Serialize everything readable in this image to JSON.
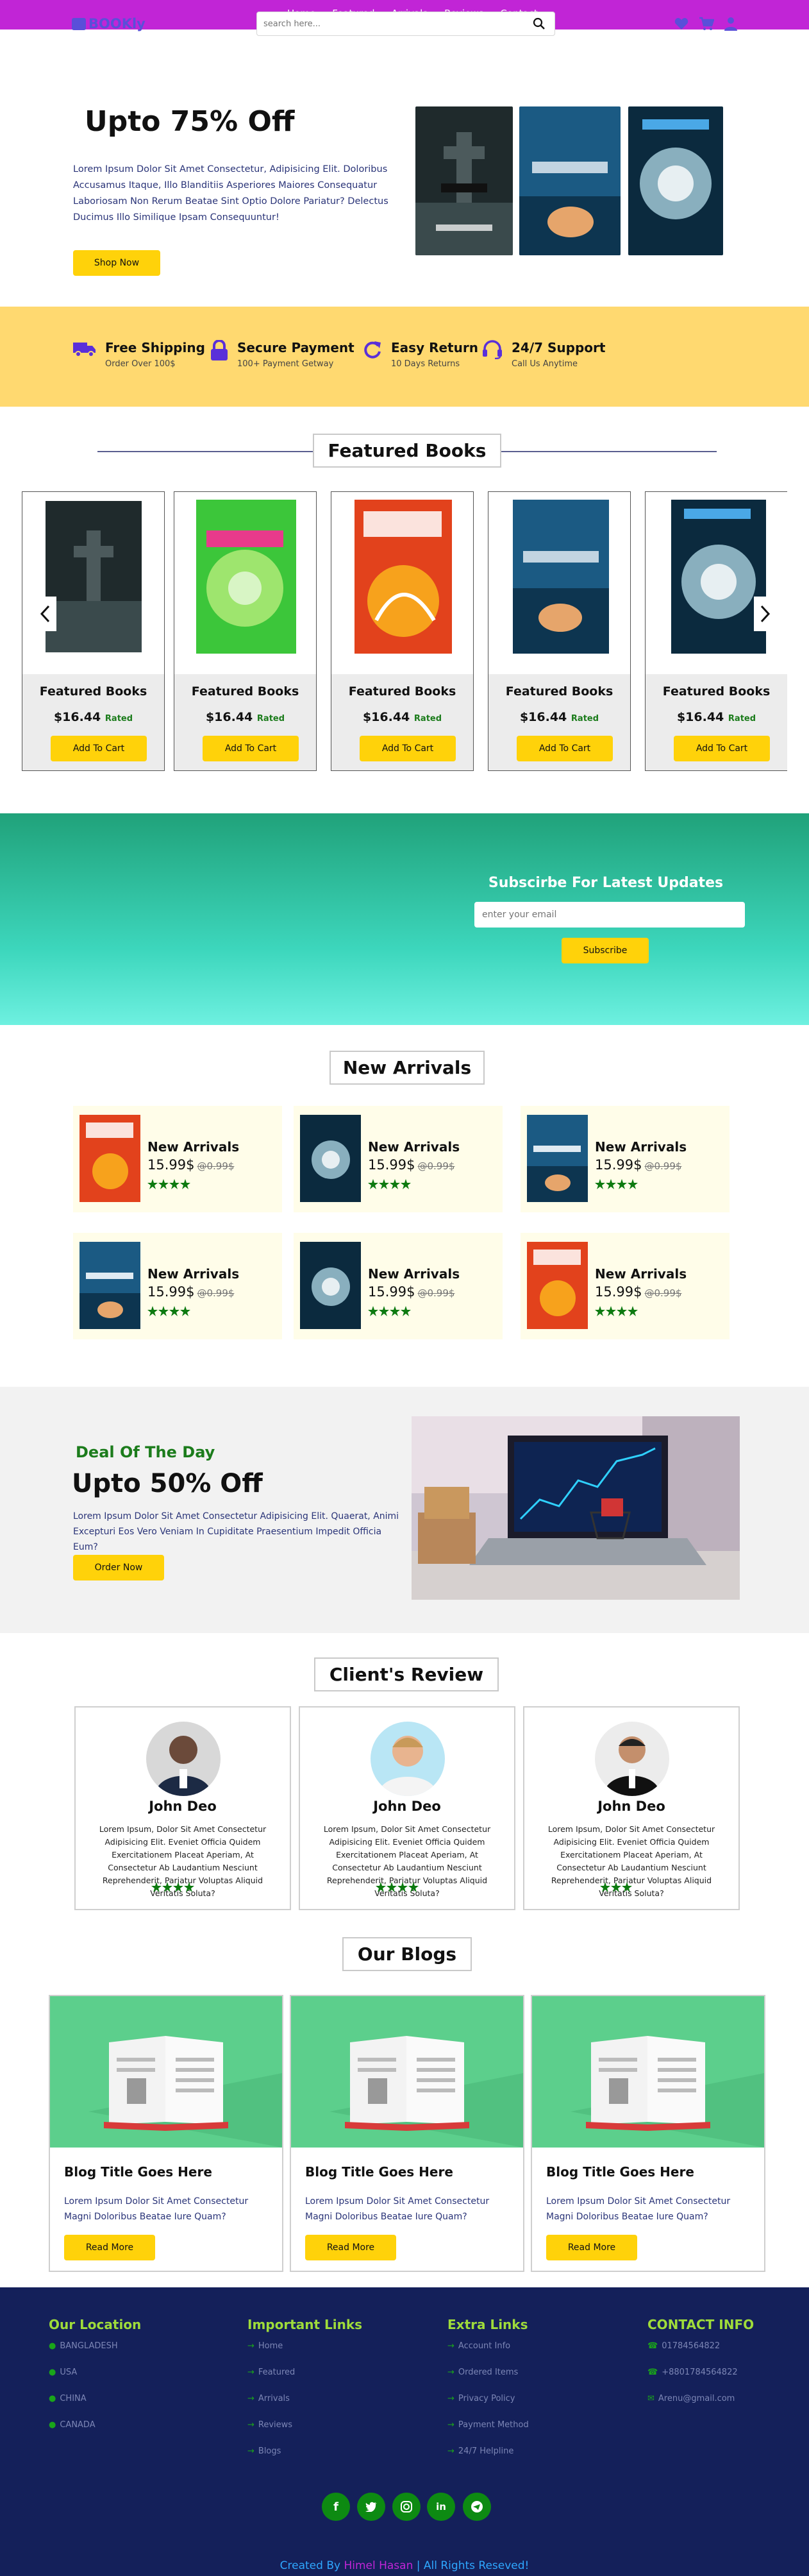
{
  "header": {
    "logo": "BOOKly",
    "nav": [
      "Home",
      "Featured",
      "Arrivals",
      "Reviews",
      "Contact"
    ],
    "search_placeholder": "search here..."
  },
  "hero": {
    "title": "Upto 75% Off",
    "text": "Lorem Ipsum Dolor Sit Amet Consectetur, Adipisicing Elit. Doloribus Accusamus Itaque, Illo Blanditiis Asperiores Maiores Consequatur Laboriosam Non Rerum Beatae Sint Optio Dolore Pariatur? Delectus Ducimus Illo Similique Ipsam Consequuntur!",
    "button": "Shop Now"
  },
  "benefits": [
    {
      "icon": "truck-icon",
      "title": "Free Shipping",
      "sub": "Order Over 100$"
    },
    {
      "icon": "lock-icon",
      "title": "Secure Payment",
      "sub": "100+ Payment Getway"
    },
    {
      "icon": "redo-icon",
      "title": "Easy Return",
      "sub": "10 Days Returns"
    },
    {
      "icon": "headset-icon",
      "title": "24/7 Support",
      "sub": "Call Us Anytime"
    }
  ],
  "featured": {
    "heading": "Featured Books",
    "cards": [
      {
        "name": "Featured Books",
        "price": "$16.44",
        "rated": "Rated",
        "button": "Add To Cart"
      },
      {
        "name": "Featured Books",
        "price": "$16.44",
        "rated": "Rated",
        "button": "Add To Cart"
      },
      {
        "name": "Featured Books",
        "price": "$16.44",
        "rated": "Rated",
        "button": "Add To Cart"
      },
      {
        "name": "Featured Books",
        "price": "$16.44",
        "rated": "Rated",
        "button": "Add To Cart"
      },
      {
        "name": "Featured Books",
        "price": "$16.44",
        "rated": "Rated",
        "button": "Add To Cart"
      }
    ]
  },
  "subscribe": {
    "title": "Subscirbe For Latest Updates",
    "placeholder": "enter your email",
    "button": "Subscribe"
  },
  "arrivals": {
    "heading": "New Arrivals",
    "cards": [
      {
        "name": "New Arrivals",
        "price": "15.99$",
        "old": "@0.99$",
        "rating": 4.5
      },
      {
        "name": "New Arrivals",
        "price": "15.99$",
        "old": "@0.99$",
        "rating": 4.5
      },
      {
        "name": "New Arrivals",
        "price": "15.99$",
        "old": "@0.99$",
        "rating": 4.5
      },
      {
        "name": "New Arrivals",
        "price": "15.99$",
        "old": "@0.99$",
        "rating": 4.5
      },
      {
        "name": "New Arrivals",
        "price": "15.99$",
        "old": "@0.99$",
        "rating": 4.5
      },
      {
        "name": "New Arrivals",
        "price": "15.99$",
        "old": "@0.99$",
        "rating": 4.5
      }
    ]
  },
  "deal": {
    "tag": "Deal Of The Day",
    "title": "Upto 50% Off",
    "text": "Lorem Ipsum Dolor Sit Amet Consectetur Adipisicing Elit. Quaerat, Animi Excepturi Eos Vero Veniam In Cupiditate Praesentium Impedit Officia Eum?",
    "button": "Order Now"
  },
  "reviews": {
    "heading": "Client's Review",
    "cards": [
      {
        "name": "John Deo",
        "text": "Lorem Ipsum, Dolor Sit Amet Consectetur Adipisicing Elit. Eveniet Officia Quidem Exercitationem Placeat Aperiam, At Consectetur Ab Laudantium Nesciunt Reprehenderit, Pariatur Voluptas Aliquid Veritatis Soluta?",
        "rating": 4.5
      },
      {
        "name": "John Deo",
        "text": "Lorem Ipsum, Dolor Sit Amet Consectetur Adipisicing Elit. Eveniet Officia Quidem Exercitationem Placeat Aperiam, At Consectetur Ab Laudantium Nesciunt Reprehenderit, Pariatur Voluptas Aliquid Veritatis Soluta?",
        "rating": 4.5
      },
      {
        "name": "John Deo",
        "text": "Lorem Ipsum, Dolor Sit Amet Consectetur Adipisicing Elit. Eveniet Officia Quidem Exercitationem Placeat Aperiam, At Consectetur Ab Laudantium Nesciunt Reprehenderit, Pariatur Voluptas Aliquid Veritatis Soluta?",
        "rating": 3.5
      }
    ]
  },
  "blogs": {
    "heading": "Our Blogs",
    "cards": [
      {
        "title": "Blog Title Goes Here",
        "text": "Lorem Ipsum Dolor Sit Amet Consectetur Magni Doloribus Beatae Iure Quam?",
        "button": "Read More"
      },
      {
        "title": "Blog Title Goes Here",
        "text": "Lorem Ipsum Dolor Sit Amet Consectetur Magni Doloribus Beatae Iure Quam?",
        "button": "Read More"
      },
      {
        "title": "Blog Title Goes Here",
        "text": "Lorem Ipsum Dolor Sit Amet Consectetur Magni Doloribus Beatae Iure Quam?",
        "button": "Read More"
      }
    ]
  },
  "footer": {
    "location": {
      "title": "Our Location",
      "items": [
        "BANGLADESH",
        "USA",
        "CHINA",
        "CANADA"
      ]
    },
    "links": {
      "title": "Important Links",
      "items": [
        "Home",
        "Featured",
        "Arrivals",
        "Reviews",
        "Blogs"
      ]
    },
    "extra": {
      "title": "Extra Links",
      "items": [
        "Account Info",
        "Ordered Items",
        "Privacy Policy",
        "Payment Method",
        "24/7 Helpline"
      ]
    },
    "contact": {
      "title": "CONTACT INFO",
      "items": [
        "01784564822",
        "+8801784564822",
        "Arenu@gmail.com"
      ]
    },
    "credit_a": "Created By ",
    "credit_b": "Himel Hasan",
    "credit_c": " | All Rights Reseved!"
  },
  "colors": {
    "accent": "#c125d6",
    "button": "#ffd20a",
    "star": "#0d7a10",
    "footer": "#14205a"
  }
}
